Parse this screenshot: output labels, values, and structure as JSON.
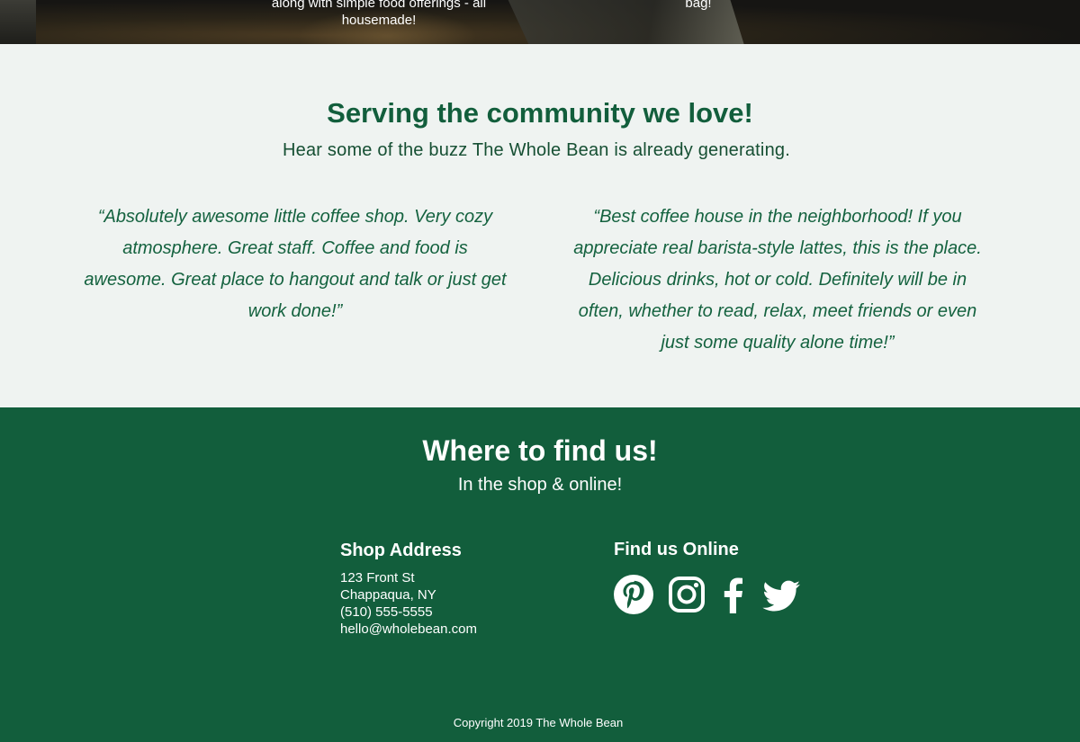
{
  "hero": {
    "text_left": "along with simple food offerings - all housemade!",
    "text_right": "bag!"
  },
  "testimonials": {
    "title": "Serving the community we love!",
    "subtitle": "Hear some of the buzz The Whole Bean is already generating.",
    "quotes": [
      "“Absolutely awesome little coffee shop. Very cozy atmosphere. Great staff. Coffee and food is awesome. Great place to hangout and talk or just get work done!”",
      "“Best coffee house in the neighborhood! If you appreciate real barista-style lattes, this is the place. Delicious drinks, hot or cold. Definitely will be in often, whether to read, relax, meet friends or even just some quality alone time!”"
    ]
  },
  "find": {
    "title": "Where to find us!",
    "subtitle": "In the shop & online!",
    "address": {
      "heading": "Shop Address",
      "street": "123 Front St",
      "city": "Chappaqua, NY",
      "phone": "(510) 555-5555",
      "email": "hello@wholebean.com"
    },
    "online": {
      "heading": "Find us Online",
      "icons": [
        "pinterest-icon",
        "instagram-icon",
        "facebook-icon",
        "twitter-icon"
      ]
    }
  },
  "footer": {
    "copyright": "Copyright 2019 The Whole Bean"
  },
  "colors": {
    "brand_green": "#125e3c",
    "light_bg": "#eff3f1",
    "white": "#ffffff"
  }
}
